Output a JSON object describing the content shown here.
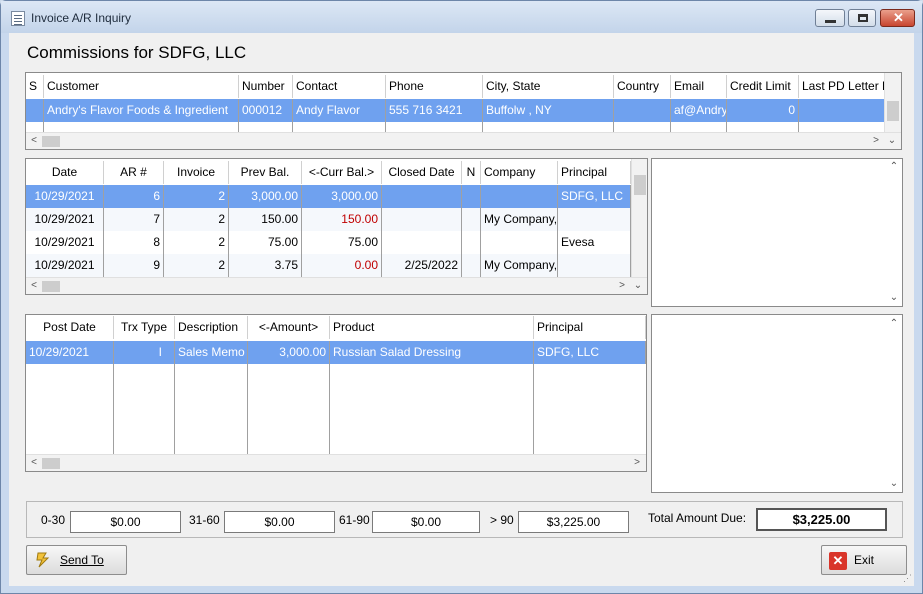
{
  "window": {
    "title": "Invoice A/R Inquiry"
  },
  "heading": "Commissions for SDFG, LLC",
  "customers": {
    "columns": [
      "S",
      "Customer",
      "Number",
      "Contact",
      "Phone",
      "City, State",
      "Country",
      "Email",
      "Credit Limit",
      "Last PD Letter P"
    ],
    "rows": [
      [
        "",
        "Andry's Flavor Foods & Ingredient",
        "000012",
        "Andy  Flavor",
        "555 716 3421",
        "Buffolw , NY",
        "",
        "af@Andry",
        "0",
        ""
      ]
    ]
  },
  "ar": {
    "columns": [
      "Date",
      "AR #",
      "Invoice",
      "Prev Bal.",
      "<-Curr Bal.>",
      "Closed Date",
      "N",
      "Company",
      "Principal"
    ],
    "rows": [
      [
        "10/29/2021",
        "6",
        "2",
        "3,000.00",
        "3,000.00",
        "",
        "",
        "",
        "SDFG, LLC"
      ],
      [
        "10/29/2021",
        "7",
        "2",
        "150.00",
        "150.00",
        "",
        "",
        "My Company,",
        ""
      ],
      [
        "10/29/2021",
        "8",
        "2",
        "75.00",
        "75.00",
        "",
        "",
        "",
        "Evesa"
      ],
      [
        "10/29/2021",
        "9",
        "2",
        "3.75",
        "0.00",
        "2/25/2022",
        "",
        "My Company,",
        ""
      ]
    ],
    "red_curr_rows": [
      1,
      3
    ]
  },
  "transactions": {
    "columns": [
      "Post Date",
      "Trx Type",
      "Description",
      "<-Amount>",
      "Product",
      "Principal"
    ],
    "rows": [
      [
        "10/29/2021",
        "I",
        "Sales Memo",
        "3,000.00",
        "Russian Salad Dressing",
        "SDFG, LLC"
      ]
    ]
  },
  "aging": {
    "b0_30_label": "0-30",
    "b0_30": "$0.00",
    "b31_60_label": "31-60",
    "b31_60": "$0.00",
    "b61_90_label": "61-90",
    "b61_90": "$0.00",
    "b90_label": "> 90",
    "b90": "$3,225.00",
    "total_label": "Total Amount Due:",
    "total": "$3,225.00"
  },
  "buttons": {
    "send_to": "Send To",
    "exit": "Exit"
  },
  "colors": {
    "selection": "#6fa1ef",
    "negative": "#c00000"
  },
  "icons": {
    "send": "send-to-icon",
    "exit": "exit-icon"
  }
}
